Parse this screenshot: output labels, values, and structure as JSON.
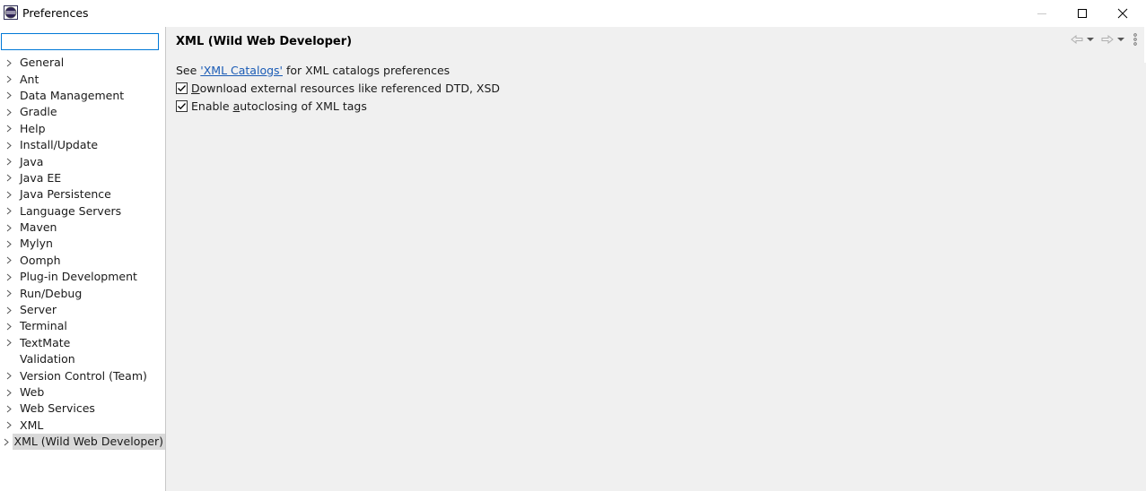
{
  "window": {
    "title": "Preferences"
  },
  "filter": {
    "value": "",
    "placeholder": ""
  },
  "tree": {
    "items": [
      {
        "label": "General",
        "expandable": true
      },
      {
        "label": "Ant",
        "expandable": true
      },
      {
        "label": "Data Management",
        "expandable": true
      },
      {
        "label": "Gradle",
        "expandable": true
      },
      {
        "label": "Help",
        "expandable": true
      },
      {
        "label": "Install/Update",
        "expandable": true
      },
      {
        "label": "Java",
        "expandable": true
      },
      {
        "label": "Java EE",
        "expandable": true
      },
      {
        "label": "Java Persistence",
        "expandable": true
      },
      {
        "label": "Language Servers",
        "expandable": true
      },
      {
        "label": "Maven",
        "expandable": true
      },
      {
        "label": "Mylyn",
        "expandable": true
      },
      {
        "label": "Oomph",
        "expandable": true
      },
      {
        "label": "Plug-in Development",
        "expandable": true
      },
      {
        "label": "Run/Debug",
        "expandable": true
      },
      {
        "label": "Server",
        "expandable": true
      },
      {
        "label": "Terminal",
        "expandable": true
      },
      {
        "label": "TextMate",
        "expandable": true
      },
      {
        "label": "Validation",
        "expandable": false
      },
      {
        "label": "Version Control (Team)",
        "expandable": true
      },
      {
        "label": "Web",
        "expandable": true
      },
      {
        "label": "Web Services",
        "expandable": true
      },
      {
        "label": "XML",
        "expandable": true
      },
      {
        "label": "XML (Wild Web Developer)",
        "expandable": true,
        "selected": true
      }
    ]
  },
  "page": {
    "title": "XML (Wild Web Developer)",
    "see_prefix": "See ",
    "catalogs_link": "'XML Catalogs'",
    "see_suffix": " for XML catalogs preferences",
    "download_mnemonic": "D",
    "download_rest": "ownload external resources like referenced DTD, XSD",
    "download_checked": true,
    "autoclose_prefix": "Enable ",
    "autoclose_mnemonic": "a",
    "autoclose_rest": "utoclosing of XML tags",
    "autoclose_checked": true
  },
  "icons": {
    "app": "eclipse-icon",
    "back": "back-arrow-icon",
    "forward": "forward-arrow-icon",
    "menu": "view-menu-icon"
  }
}
